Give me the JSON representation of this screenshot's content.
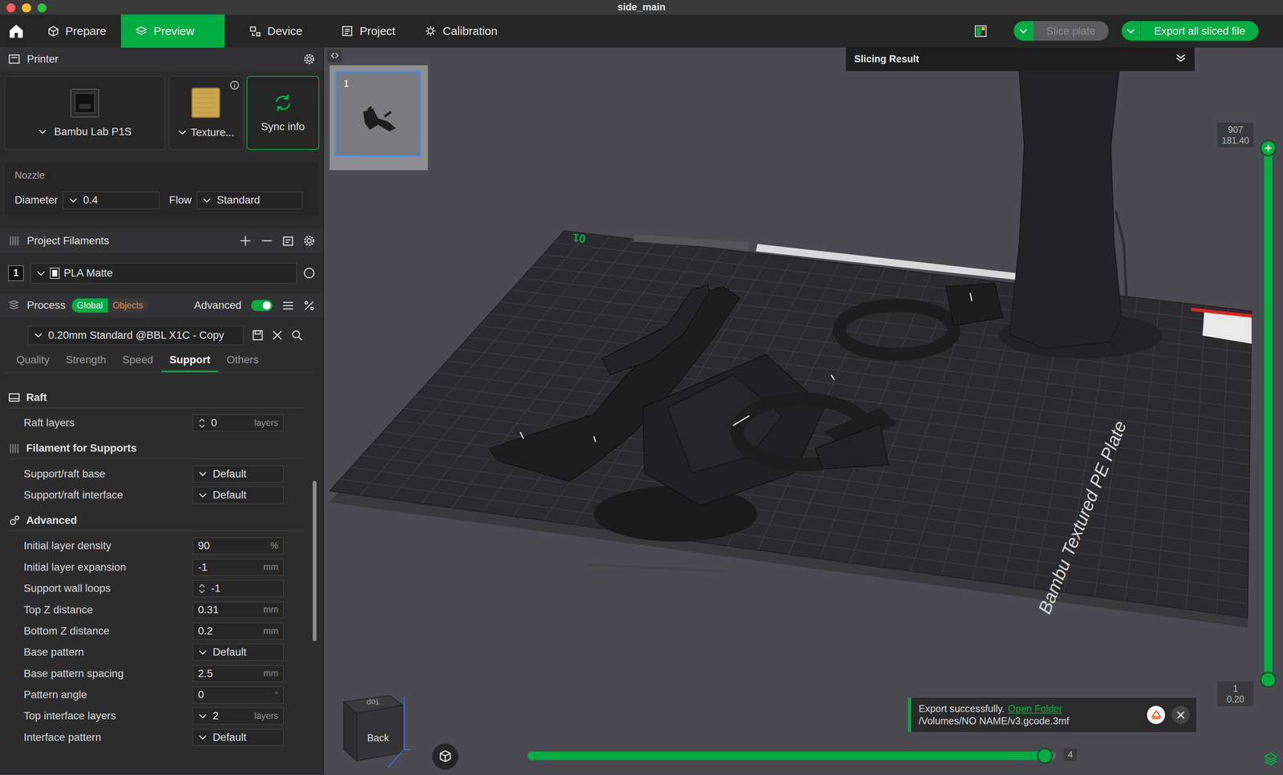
{
  "window": {
    "title": "side_main"
  },
  "tabs": [
    {
      "label": "Prepare",
      "selected": false
    },
    {
      "label": "Preview",
      "selected": true
    },
    {
      "label": "Device",
      "selected": false
    },
    {
      "label": "Project",
      "selected": false
    },
    {
      "label": "Calibration",
      "selected": false
    }
  ],
  "toolbar": {
    "slice": {
      "label": "Slice plate",
      "disabled": true
    },
    "export": {
      "label": "Export all sliced file",
      "disabled": false
    }
  },
  "printer": {
    "title": "Printer",
    "model": "Bambu Lab P1S",
    "plate": "Texture...",
    "sync": "Sync info"
  },
  "nozzle": {
    "title": "Nozzle",
    "diameter_label": "Diameter",
    "diameter": "0.4",
    "flow_label": "Flow",
    "flow": "Standard"
  },
  "filaments": {
    "title": "Project Filaments",
    "items": [
      {
        "index": "1",
        "name": "PLA Matte"
      }
    ]
  },
  "process": {
    "title": "Process",
    "scope": [
      {
        "label": "Global",
        "selected": true
      },
      {
        "label": "Objects",
        "selected": false
      }
    ],
    "advanced_label": "Advanced",
    "advanced": true,
    "preset": "0.20mm Standard @BBL X1C - Copy"
  },
  "process_tabs": [
    {
      "label": "Quality",
      "selected": false
    },
    {
      "label": "Strength",
      "selected": false
    },
    {
      "label": "Speed",
      "selected": false
    },
    {
      "label": "Support",
      "selected": true
    },
    {
      "label": "Others",
      "selected": false
    }
  ],
  "sections": [
    {
      "title": "Raft",
      "rows": [
        {
          "label": "Raft layers",
          "value": "0",
          "unit": "layers",
          "kind": "spin"
        }
      ]
    },
    {
      "title": "Filament for Supports",
      "rows": [
        {
          "label": "Support/raft base",
          "value": "Default",
          "unit": "",
          "kind": "select"
        },
        {
          "label": "Support/raft interface",
          "value": "Default",
          "unit": "",
          "kind": "select"
        }
      ]
    },
    {
      "title": "Advanced",
      "rows": [
        {
          "label": "Initial layer density",
          "value": "90",
          "unit": "%",
          "kind": "text"
        },
        {
          "label": "Initial layer expansion",
          "value": "-1",
          "unit": "mm",
          "kind": "text"
        },
        {
          "label": "Support wall loops",
          "value": "-1",
          "unit": "",
          "kind": "spin"
        },
        {
          "label": "Top Z distance",
          "value": "0.31",
          "unit": "mm",
          "kind": "text"
        },
        {
          "label": "Bottom Z distance",
          "value": "0.2",
          "unit": "mm",
          "kind": "text"
        },
        {
          "label": "Base pattern",
          "value": "Default",
          "unit": "",
          "kind": "select"
        },
        {
          "label": "Base pattern spacing",
          "value": "2.5",
          "unit": "mm",
          "kind": "text"
        },
        {
          "label": "Pattern angle",
          "value": "0",
          "unit": "°",
          "kind": "text"
        },
        {
          "label": "Top interface layers",
          "value": "2",
          "unit": "layers",
          "kind": "select"
        },
        {
          "label": "Interface pattern",
          "value": "Default",
          "unit": "",
          "kind": "select"
        }
      ]
    }
  ],
  "viewport": {
    "plate_number": "1",
    "plate_label": "Bambu Textured PE Plate",
    "plate_index": "01",
    "cube": {
      "front": "Back",
      "top": "Top"
    }
  },
  "slicing_result": {
    "title": "Slicing Result",
    "expanded": false
  },
  "layer_slider": {
    "top": {
      "layer": "907",
      "height": "181.40"
    },
    "bottom": {
      "layer": "1",
      "height": "0.20"
    },
    "level": 1
  },
  "move_slider": {
    "level": 0.98,
    "reading": "4"
  },
  "toast": {
    "message": "Export successfully.",
    "link": "Open Folder",
    "path": "/Volumes/NO NAME/v3.gcode.3mf"
  }
}
